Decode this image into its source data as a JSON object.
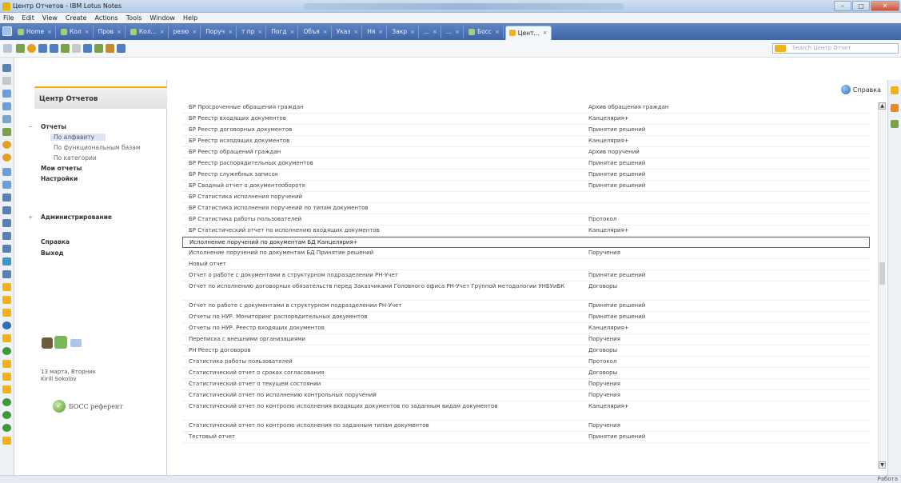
{
  "window": {
    "title": "Центр Отчетов - IBM Lotus Notes"
  },
  "menu": [
    "File",
    "Edit",
    "View",
    "Create",
    "Actions",
    "Tools",
    "Window",
    "Help"
  ],
  "tabs": [
    {
      "label": "Home"
    },
    {
      "label": "Кол"
    },
    {
      "label": "Пров"
    },
    {
      "label": "Кол..."
    },
    {
      "label": "резю"
    },
    {
      "label": "Поруч"
    },
    {
      "label": "т пр"
    },
    {
      "label": "Погд"
    },
    {
      "label": "Объя"
    },
    {
      "label": "Указ"
    },
    {
      "label": "Ня"
    },
    {
      "label": "Закр"
    },
    {
      "label": "..."
    },
    {
      "label": "..."
    },
    {
      "label": "Босс"
    },
    {
      "label": "Цент...",
      "active": true
    }
  ],
  "search": {
    "placeholder": "Search Центр Отчет"
  },
  "nav": {
    "header": "Центр Отчетов",
    "reports_toggle": "−",
    "reports": "Отчеты",
    "by_alpha": "По алфавиту",
    "by_db": "По функциональным базам",
    "by_category": "По категории",
    "my_reports": "Мои отчеты",
    "settings": "Настройки",
    "admin_toggle": "+",
    "admin": "Администрирование",
    "help": "Справка",
    "exit": "Выход"
  },
  "user": {
    "line1": "13 марта, Вторник",
    "line2": "Kirill Sokolov"
  },
  "boss": {
    "label": "БОСС референт",
    "icon": "check-icon"
  },
  "main": {
    "help_label": "Справка"
  },
  "reports": [
    {
      "name": "БР Просроченные обращения граждан",
      "category": "Архив обращения граждан"
    },
    {
      "name": "БР Реестр входящих документов",
      "category": "Канцелярия+"
    },
    {
      "name": "БР Реестр договорных документов",
      "category": "Принятие решений"
    },
    {
      "name": "БР Реестр исходящих документов",
      "category": "Канцелярия+"
    },
    {
      "name": "БР Реестр обращений граждан",
      "category": "Архив поручений"
    },
    {
      "name": "БР Реестр распорядительных документов",
      "category": "Принятие решений"
    },
    {
      "name": "БР Реестр служебных записок",
      "category": "Принятие решений"
    },
    {
      "name": "БР Сводный отчет о документообороте",
      "category": "Принятие решений"
    },
    {
      "name": "БР Статистика исполнения поручений",
      "category": ""
    },
    {
      "name": "БР Статистика исполнения поручений по типам документов",
      "category": ""
    },
    {
      "name": "БР Статистика работы пользователей",
      "category": "Протокол"
    },
    {
      "name": "БР Статистический отчет по исполнению входящих документов",
      "category": "Канцелярия+"
    },
    {
      "name": "Исполнение поручений по документам БД Канцелярия+",
      "category": "",
      "highlight": true
    },
    {
      "name": "Исполнение поручений по документам БД Принятие решений",
      "category": "Поручения"
    },
    {
      "name": "Новый отчет",
      "category": ""
    },
    {
      "name": "Отчет о работе с документами в структурном подразделении РН-Учет",
      "category": "Принятие решений"
    },
    {
      "name": "Отчет по исполнению договорных обязательств перед Заказчиками Головного офиса РН-Учет Группой методологии УНБУиБК",
      "category": "Договоры",
      "tall": true
    },
    {
      "name": "Отчет по работе с документами в структурном подразделении РН-Учет",
      "category": "Принятие решений"
    },
    {
      "name": "Отчеты по НУР. Мониторинг распорядительных документов",
      "category": "Принятие решений"
    },
    {
      "name": "Отчеты по НУР. Реестр входящих документов",
      "category": "Канцелярия+"
    },
    {
      "name": "Переписка с внешними организациями",
      "category": "Поручения"
    },
    {
      "name": "РН Реестр договоров",
      "category": "Договоры"
    },
    {
      "name": "Статистика работы пользователей",
      "category": "Протокол"
    },
    {
      "name": "Статистический отчет о сроках согласования",
      "category": "Договоры"
    },
    {
      "name": "Статистический отчет о текущем состоянии",
      "category": "Поручения"
    },
    {
      "name": "Статистический отчет по исполнению контрольных поручений",
      "category": "Поручения"
    },
    {
      "name": "Статистический отчет по контролю исполнения входящих документов по заданным видам документов",
      "category": "Канцелярия+",
      "tall": true
    },
    {
      "name": "Статистический отчет по контролю исполнения по заданным типам документов",
      "category": "Поручения"
    },
    {
      "name": "Тестовый отчет",
      "category": "Принятие решений"
    }
  ],
  "status": {
    "right": "Работа"
  },
  "colors": {
    "accent": "#e8b400",
    "tabbar": "#4a70b4",
    "selection": "#dbe6f4"
  }
}
